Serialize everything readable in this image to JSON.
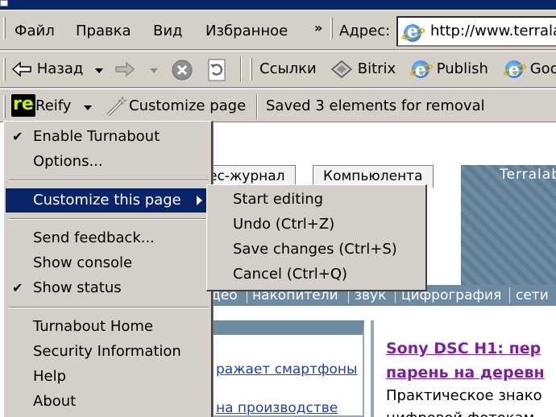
{
  "menubar": {
    "items": [
      "Файл",
      "Правка",
      "Вид",
      "Избранное"
    ],
    "more": "»",
    "address_label": "Адрес:",
    "address_value": "http://www.terralab"
  },
  "navbar": {
    "back_label": "Назад",
    "links_label": "Ссылки",
    "links": [
      "Bitrix",
      "Publish",
      "Goo"
    ]
  },
  "reifybar": {
    "logo_text": "re",
    "reify_label": "Reify",
    "customize_label": "Customize page",
    "status": "Saved 3 elements for removal"
  },
  "menu": {
    "group1": [
      {
        "label": "Enable Turnabout",
        "checked": true
      },
      {
        "label": "Options...",
        "checked": false
      }
    ],
    "customize_label": "Customize this page",
    "group3": [
      {
        "label": "Send feedback...",
        "checked": false
      },
      {
        "label": "Show console",
        "checked": false
      },
      {
        "label": "Show status",
        "checked": true
      }
    ],
    "group4": [
      "Turnabout Home",
      "Security Information",
      "Help",
      "About"
    ],
    "check_glyph": "✔"
  },
  "submenu": {
    "items": [
      "Start editing",
      "Undo (Ctrl+Z)",
      "Save changes (Ctrl+S)",
      "Cancel (Ctrl+Q)"
    ]
  },
  "page": {
    "tabs": [
      "ес-журнал",
      "Компьюлента"
    ],
    "banner_title": "Terralab",
    "categories": [
      "део",
      "накопители",
      "звук",
      "цифрография",
      "сети"
    ],
    "left_links": [
      "ражает смартфоны",
      "на производстве"
    ],
    "news_title_lines": [
      "Sony DSC H1: пер",
      "парень на деревн"
    ],
    "news_text_lines": [
      "Практическое знако",
      "цифровой фотокам"
    ]
  },
  "colors": {
    "chrome": "#d4d0c8",
    "selection": "#0a246a",
    "category_bar": "#6e8aa0",
    "news_title": "#7c1fa0",
    "link": "#1a3fb8"
  }
}
